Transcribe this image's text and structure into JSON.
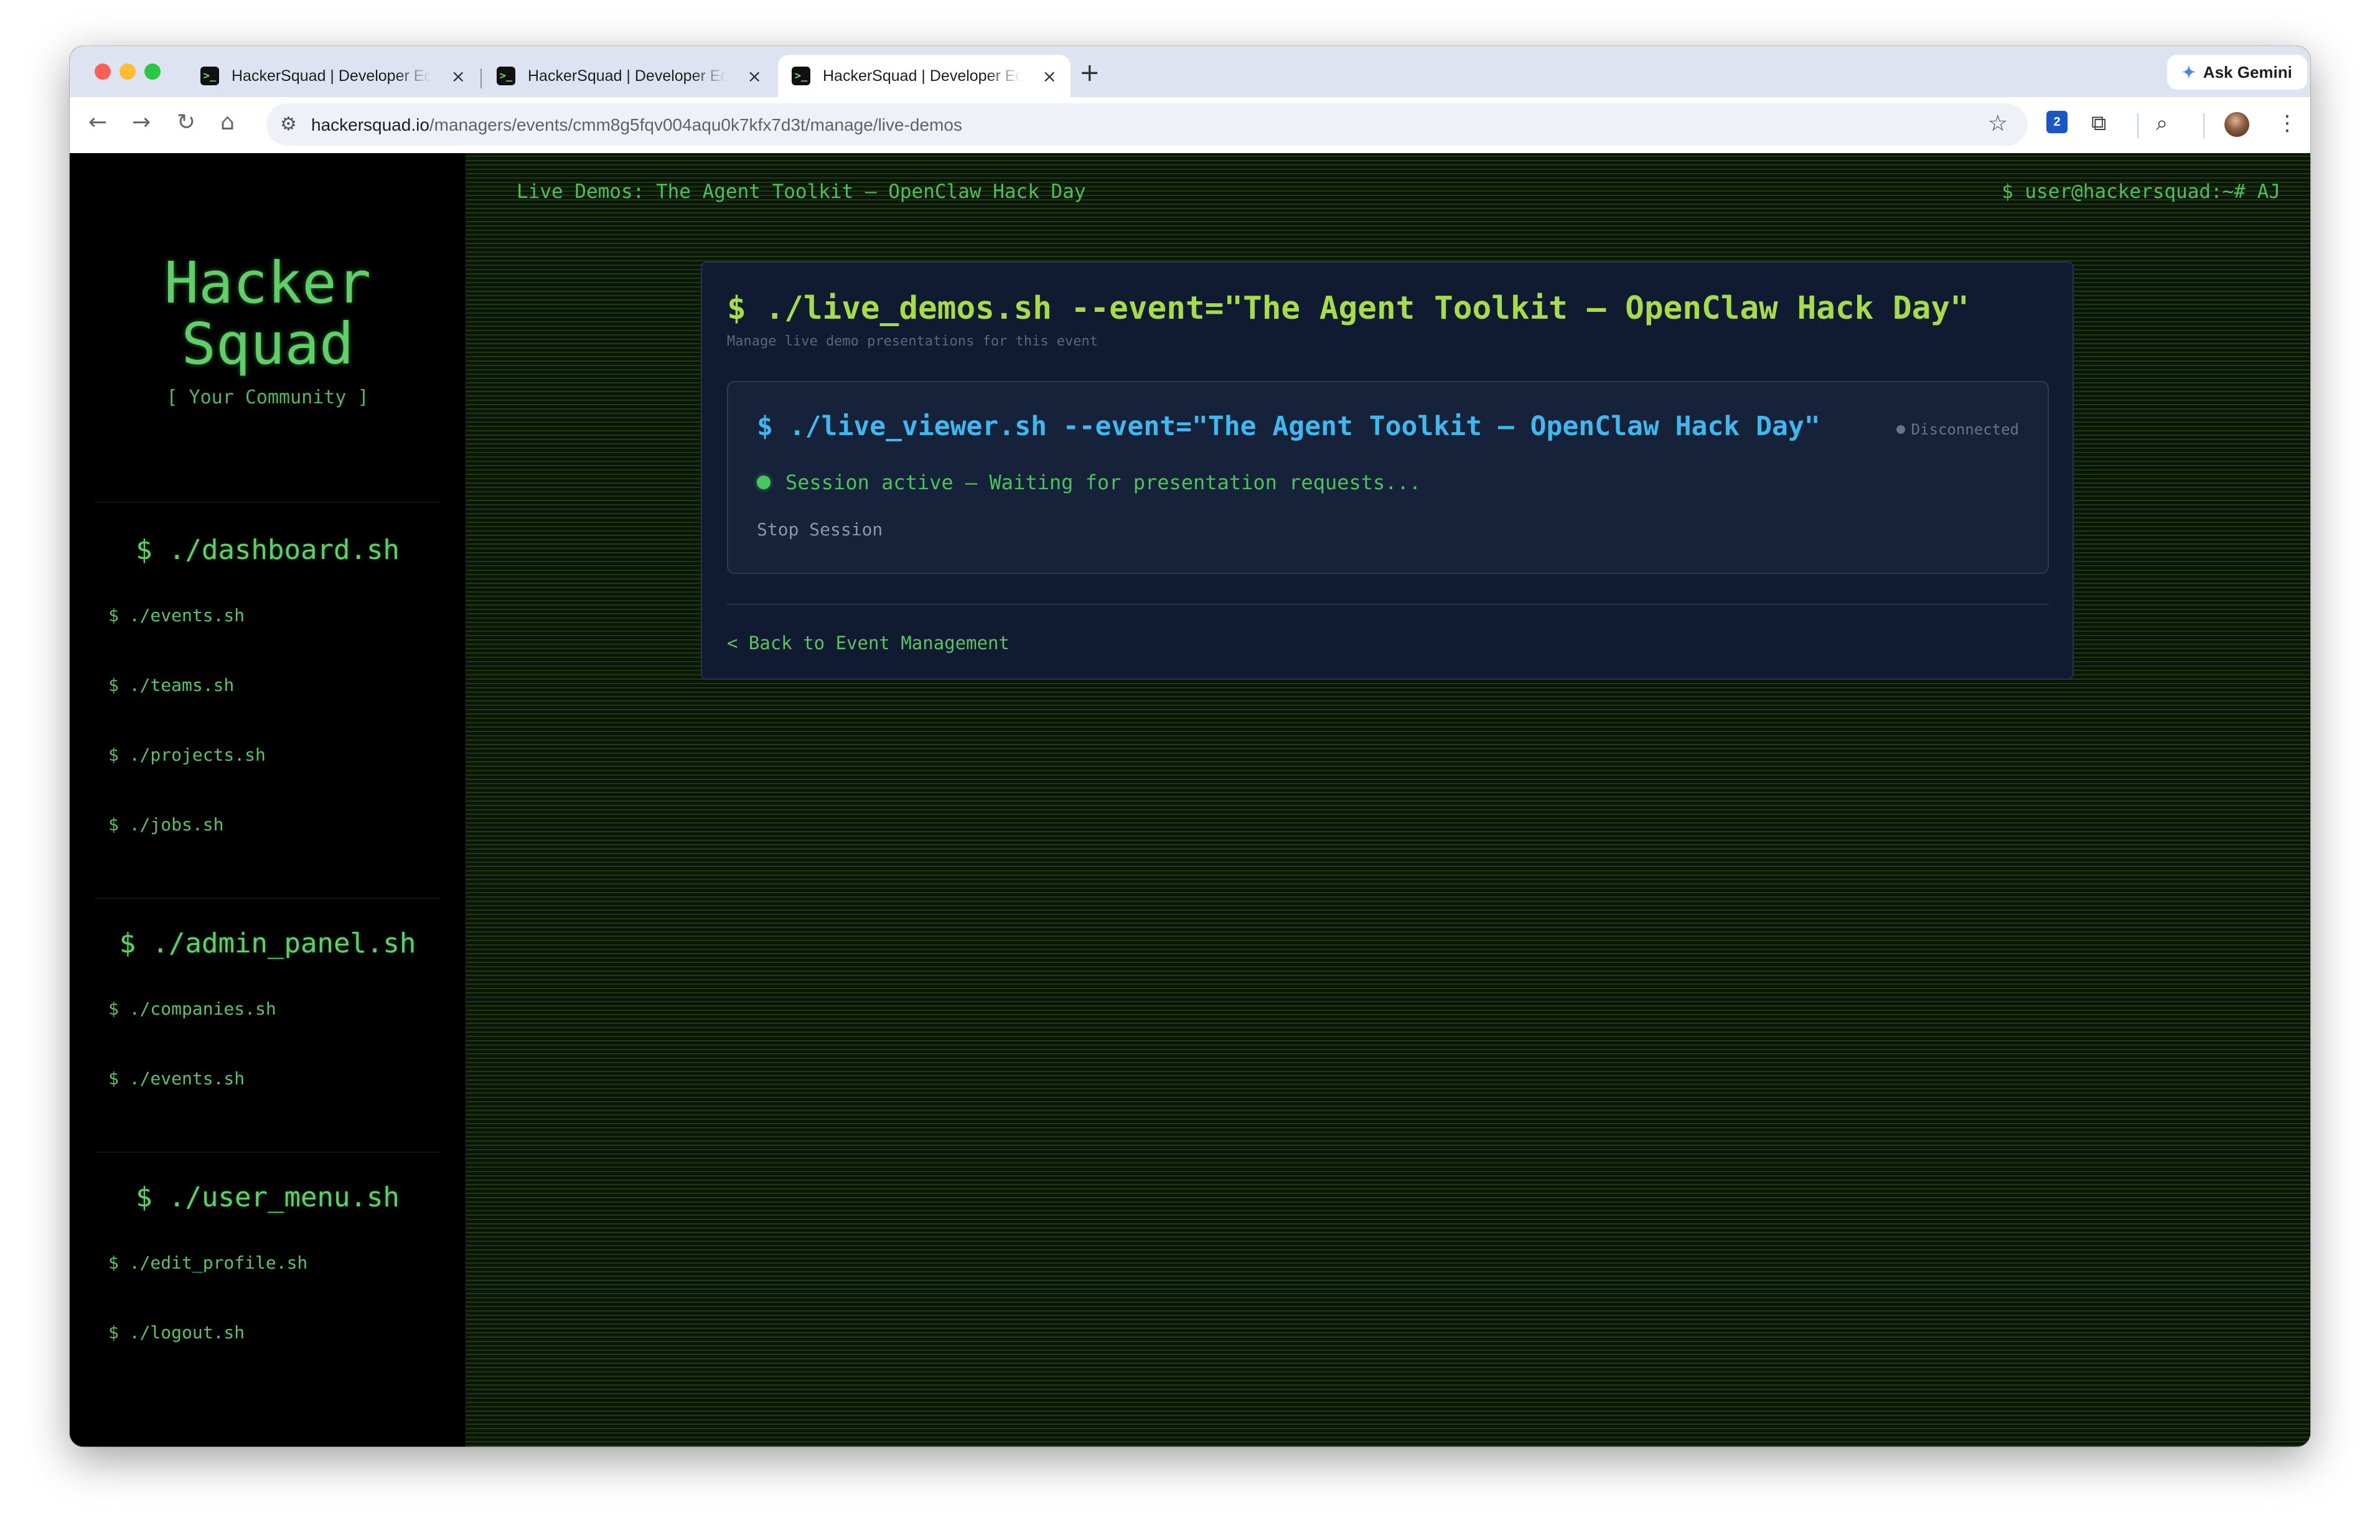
{
  "browser": {
    "tabs": [
      {
        "title": "HackerSquad | Developer Ecosystem",
        "favicon": "terminal-prompt-icon",
        "active": false
      },
      {
        "title": "HackerSquad | Developer Ecosystem",
        "favicon": "terminal-prompt-icon",
        "active": false
      },
      {
        "title": "HackerSquad | Developer Ecosystem",
        "favicon": "terminal-prompt-icon",
        "active": true
      }
    ],
    "favicon_glyph": ">_",
    "close_glyph": "×",
    "new_tab_glyph": "+",
    "ask_gemini_label": "Ask Gemini",
    "url_host": "hackersquad.io",
    "url_path": "/managers/events/cmm8g5fqv004aqu0k7kfx7d3t/manage/live-demos",
    "extensions_badge_count": "2"
  },
  "sidebar": {
    "logo_line1": "Hacker",
    "logo_line2": "Squad",
    "tagline": "[ Your Community ]",
    "sections": [
      {
        "heading": "$ ./dashboard.sh",
        "items": [
          "$ ./events.sh",
          "$ ./teams.sh",
          "$ ./projects.sh",
          "$ ./jobs.sh"
        ]
      },
      {
        "heading": "$ ./admin_panel.sh",
        "items": [
          "$ ./companies.sh",
          "$ ./events.sh"
        ]
      },
      {
        "heading": "$ ./user_menu.sh",
        "items": [
          "$ ./edit_profile.sh",
          "$ ./logout.sh"
        ]
      }
    ]
  },
  "header": {
    "title": "Live Demos: The Agent Toolkit — OpenClaw Hack Day",
    "user": "$ user@hackersquad:~# AJ"
  },
  "card": {
    "title": "$ ./live_demos.sh --event=\"The Agent Toolkit — OpenClaw Hack Day\"",
    "subtitle": "Manage live demo presentations for this event",
    "viewer": {
      "title": "$ ./live_viewer.sh --event=\"The Agent Toolkit — OpenClaw Hack Day\"",
      "connection_status": "Disconnected",
      "session_text": "Session active — Waiting for presentation requests...",
      "stop_button": "Stop Session"
    },
    "back_link": "< Back to Event Management"
  },
  "colors": {
    "terminal_green": "#5fcf68",
    "card_title_lime": "#a6dc48",
    "viewer_title_blue": "#3fb8f0",
    "card_bg": "#101a30",
    "status_gray": "#6b7380"
  }
}
